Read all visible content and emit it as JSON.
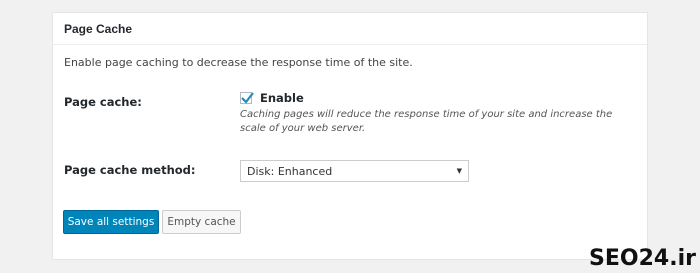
{
  "panel": {
    "title": "Page Cache",
    "intro": "Enable page caching to decrease the response time of the site."
  },
  "page_cache": {
    "label": "Page cache:",
    "checkbox_label": "Enable",
    "checked": true,
    "description": "Caching pages will reduce the response time of your site and increase the scale of your web server."
  },
  "cache_method": {
    "label": "Page cache method:",
    "selected": "Disk: Enhanced"
  },
  "buttons": {
    "save": "Save all settings",
    "empty": "Empty cache"
  },
  "watermark": "SEO24.ir"
}
